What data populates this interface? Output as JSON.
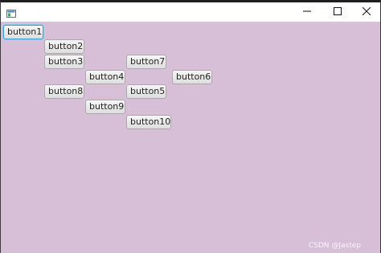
{
  "window": {
    "controls": {
      "minimize_icon": "minimize-icon",
      "maximize_icon": "maximize-icon",
      "close_icon": "close-icon"
    },
    "app_icon": "app-window-icon",
    "background_color": "#d8bfd8"
  },
  "buttons": [
    {
      "id": "button1",
      "label": "button1",
      "focused": true
    },
    {
      "id": "button2",
      "label": "button2"
    },
    {
      "id": "button3",
      "label": "button3"
    },
    {
      "id": "button4",
      "label": "button4"
    },
    {
      "id": "button5",
      "label": "button5"
    },
    {
      "id": "button6",
      "label": "button6"
    },
    {
      "id": "button7",
      "label": "button7"
    },
    {
      "id": "button8",
      "label": "button8"
    },
    {
      "id": "button9",
      "label": "button9"
    },
    {
      "id": "button10",
      "label": "button10"
    }
  ],
  "watermark": "CSDN @Jastep"
}
